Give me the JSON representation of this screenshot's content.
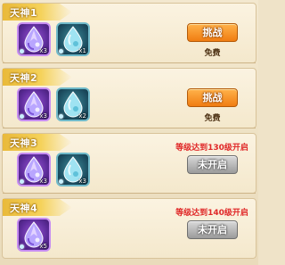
{
  "rows": [
    {
      "title": "天神1",
      "items": [
        {
          "kind": "purple",
          "icon": "purple-crystal-drop-icon",
          "qty": "x3"
        },
        {
          "kind": "teal",
          "icon": "blue-water-drop-icon",
          "qty": "x1"
        }
      ],
      "button": "挑战",
      "button_state": "active",
      "sub": "免费"
    },
    {
      "title": "天神2",
      "items": [
        {
          "kind": "purple",
          "icon": "purple-crystal-drop-icon",
          "qty": "x3"
        },
        {
          "kind": "teal",
          "icon": "blue-water-drop-icon",
          "qty": "x2"
        }
      ],
      "button": "挑战",
      "button_state": "active",
      "sub": "免费"
    },
    {
      "title": "天神3",
      "items": [
        {
          "kind": "purple",
          "icon": "purple-crystal-drop-icon",
          "qty": "x3"
        },
        {
          "kind": "teal",
          "icon": "blue-water-drop-icon",
          "qty": "x3"
        }
      ],
      "requirement": "等级达到130级开启",
      "button": "未开启",
      "button_state": "locked"
    },
    {
      "title": "天神4",
      "items": [
        {
          "kind": "purple",
          "icon": "purple-crystal-drop-icon",
          "qty": "x5"
        }
      ],
      "requirement": "等级达到140级开启",
      "button": "未开启",
      "button_state": "locked"
    }
  ],
  "colors": {
    "accent_orange": "#f07d12",
    "locked_gray": "#9b9b9b",
    "requirement_red": "#e02828",
    "tab_gold": "#f5d25a"
  }
}
